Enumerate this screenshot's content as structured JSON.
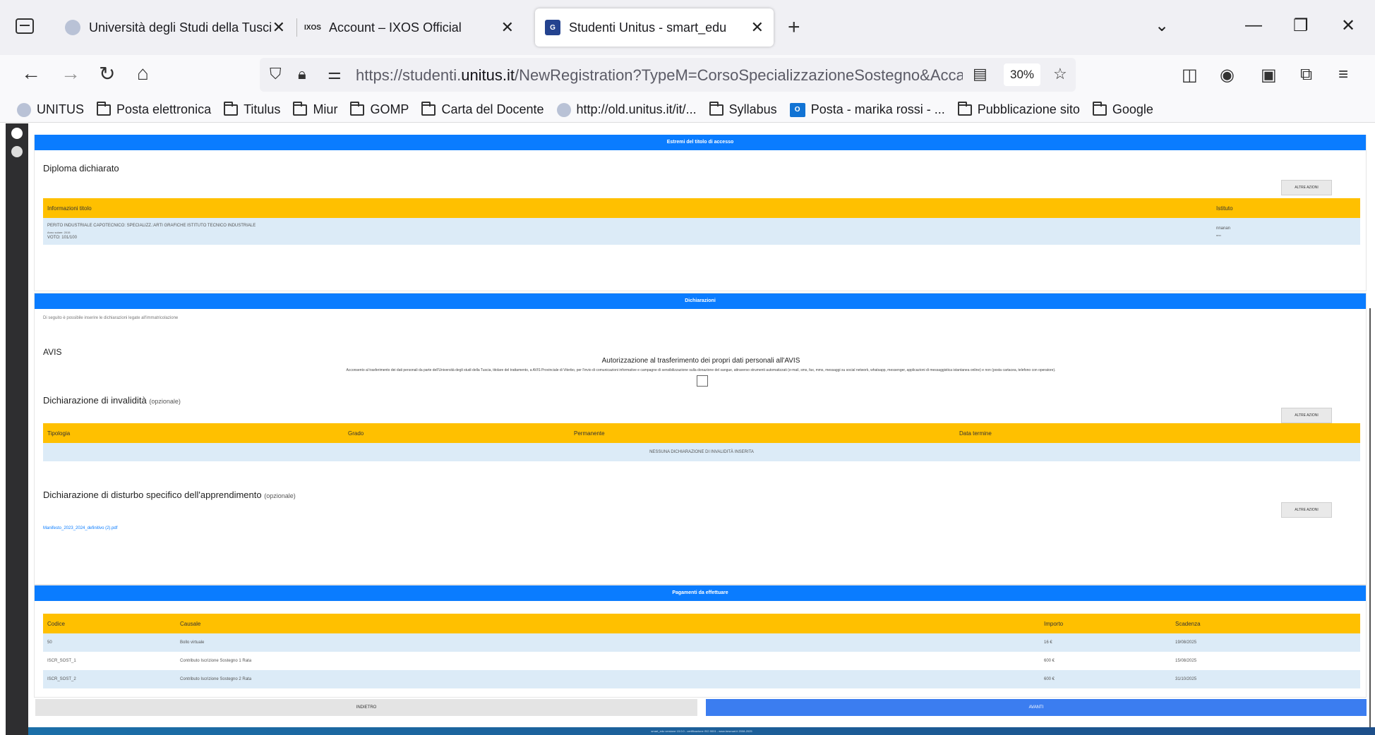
{
  "browser": {
    "tabs": [
      {
        "title": "Università degli Studi della Tuscia",
        "active": false
      },
      {
        "title": "Account – IXOS Official",
        "active": false
      },
      {
        "title": "Studenti Unitus - smart_edu",
        "active": true
      }
    ],
    "url_prefix": "https://studenti.",
    "url_domain": "unitus.it",
    "url_path": "/NewRegistration?TypeM=CorsoSpecializzazioneSostegno&AccademicYear",
    "zoom": "30%",
    "bookmarks": [
      {
        "label": "UNITUS",
        "icon": "site-icon"
      },
      {
        "label": "Posta elettronica",
        "icon": "folder-icon"
      },
      {
        "label": "Titulus",
        "icon": "folder-icon"
      },
      {
        "label": "Miur",
        "icon": "folder-icon"
      },
      {
        "label": "GOMP",
        "icon": "folder-icon"
      },
      {
        "label": "Carta del Docente",
        "icon": "folder-icon"
      },
      {
        "label": "http://old.unitus.it/it/...",
        "icon": "site-icon"
      },
      {
        "label": "Syllabus",
        "icon": "folder-icon"
      },
      {
        "label": "Posta - marika rossi - ...",
        "icon": "outlook-icon"
      },
      {
        "label": "Pubblicazione sito",
        "icon": "folder-icon"
      },
      {
        "label": "Google",
        "icon": "folder-icon"
      }
    ]
  },
  "titolo_accesso": {
    "bar": "Estremi del titolo di accesso",
    "heading": "Diploma dichiarato",
    "action": "ALTRE AZIONI",
    "col_info": "Informazioni titolo",
    "col_istituto": "Istituto",
    "row_title": "PERITO INDUSTRIALE CAPOTECNICO: SPECIALIZZ.:ARTI GRAFICHE ISTITUTO TECNICO INDUSTRIALE",
    "row_year": "Anno solare: 2015",
    "row_voto": "VOTO: 101/100",
    "row_istituto": "nnanan",
    "row_istituto2": "nnn"
  },
  "dichiarazioni": {
    "bar": "Dichiarazioni",
    "note": "Di seguito è possibile inserire le dichiarazioni legate all'immatricolazione",
    "avis_heading": "AVIS",
    "avis_title": "Autorizzazione al trasferimento dei propri dati personali all'AVIS",
    "avis_text": "Acconsento al trasferimento dei dati personali da parte dell'Università degli studi della Tuscia, titolare del trattamento, a AVIS Provinciale di Viterbo, per l'invio di comunicazioni informative e campagne di sensibilizzazione sulla donazione del sangue, attraverso strumenti automatizzati (e-mail, sms, fax, mms, messaggi su social network, whatsapp, messenger, applicazioni di messaggistica istantanea online) e non (posta cartacea, telefono con operatore).",
    "invalidita_heading": "Dichiarazione di invalidità",
    "invalidita_opt": "(opzionale)",
    "invalidita_action": "ALTRE AZIONI",
    "inv_cols": [
      "Tipologia",
      "Grado",
      "Permanente",
      "Data termine"
    ],
    "inv_empty": "NESSUNA DICHIARAZIONE DI INVALIDITÀ INSERITA",
    "dsa_heading": "Dichiarazione di disturbo specifico dell'apprendimento",
    "dsa_opt": "(opzionale)",
    "dsa_action": "ALTRE AZIONI",
    "dsa_file": "Manifesto_2023_2024_definitivo (2).pdf"
  },
  "pagamenti": {
    "bar": "Pagamenti da effettuare",
    "cols": [
      "Codice",
      "Causale",
      "Importo",
      "Scadenza"
    ],
    "rows": [
      {
        "codice": "50",
        "causale": "Bollo virtuale",
        "importo": "16 €",
        "scadenza": "19/08/2025"
      },
      {
        "codice": "ISCR_SOST_1",
        "causale": "Contributo Iscrizione Sostegno 1 Rata",
        "importo": "600 €",
        "scadenza": "15/08/2025"
      },
      {
        "codice": "ISCR_SOST_2",
        "causale": "Contributo Iscrizione Sostegno 2 Rata",
        "importo": "600 €",
        "scadenza": "31/10/2025"
      }
    ]
  },
  "buttons": {
    "back": "INDIETRO",
    "next": "AVANTI"
  },
  "footer": "smart_edu versione 15.0.0 - certificazione ISO 9001 - www.besmart.it 2008-2025"
}
